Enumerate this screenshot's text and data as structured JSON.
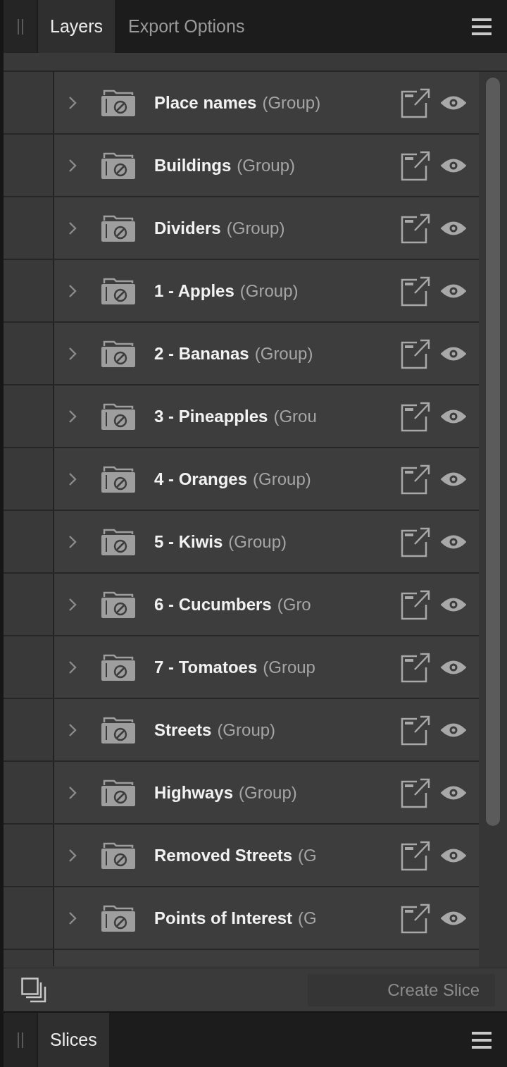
{
  "panel_tabs": [
    {
      "label": "Layers",
      "selected": true
    },
    {
      "label": "Export Options",
      "selected": false
    }
  ],
  "layers": [
    {
      "name": "Place names",
      "suffix": "(Group)",
      "expanded": false,
      "visible": true
    },
    {
      "name": "Buildings",
      "suffix": "(Group)",
      "expanded": false,
      "visible": true
    },
    {
      "name": "Dividers",
      "suffix": "(Group)",
      "expanded": false,
      "visible": true
    },
    {
      "name": "1 - Apples",
      "suffix": "(Group)",
      "expanded": false,
      "visible": true
    },
    {
      "name": "2 - Bananas",
      "suffix": "(Group)",
      "expanded": false,
      "visible": true
    },
    {
      "name": "3 - Pineapples",
      "suffix": "(Grou",
      "expanded": false,
      "visible": true
    },
    {
      "name": "4 - Oranges",
      "suffix": "(Group)",
      "expanded": false,
      "visible": true
    },
    {
      "name": "5 - Kiwis",
      "suffix": "(Group)",
      "expanded": false,
      "visible": true
    },
    {
      "name": "6 - Cucumbers",
      "suffix": "(Gro",
      "expanded": false,
      "visible": true
    },
    {
      "name": "7 - Tomatoes",
      "suffix": "(Group",
      "expanded": false,
      "visible": true
    },
    {
      "name": "Streets",
      "suffix": "(Group)",
      "expanded": false,
      "visible": true
    },
    {
      "name": "Highways",
      "suffix": "(Group)",
      "expanded": false,
      "visible": true
    },
    {
      "name": "Removed Streets",
      "suffix": "(G",
      "expanded": false,
      "visible": true
    },
    {
      "name": "Points of Interest",
      "suffix": "(G",
      "expanded": false,
      "visible": true
    }
  ],
  "footer": {
    "button": {
      "label": "Create Slice",
      "disabled": true
    }
  },
  "bottom_tabs": [
    {
      "label": "Slices",
      "selected": true
    }
  ]
}
